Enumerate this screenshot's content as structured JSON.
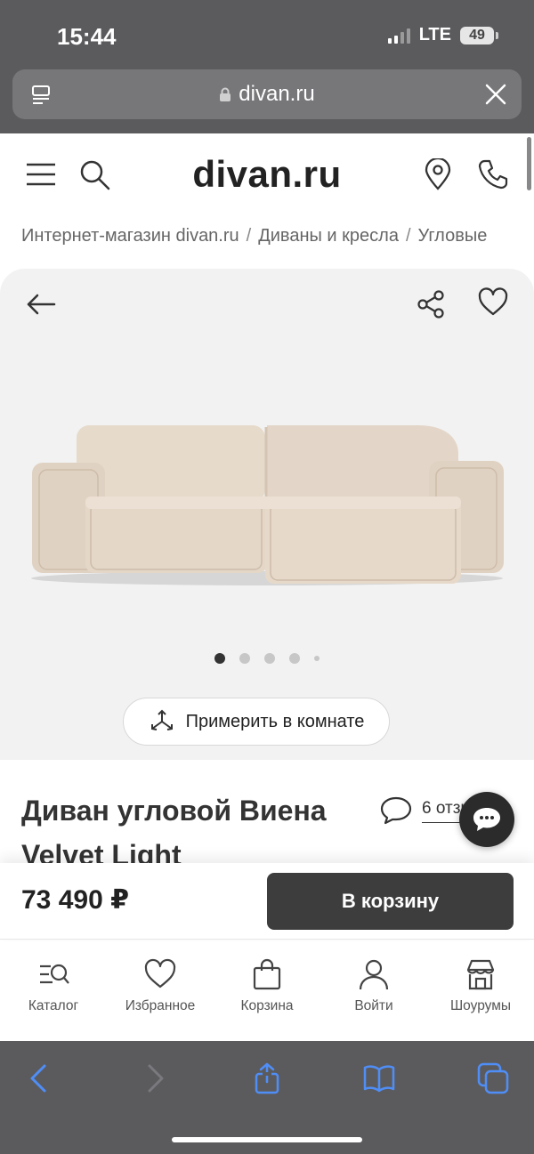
{
  "status_bar": {
    "time": "15:44",
    "network": "LTE",
    "battery": "49"
  },
  "browser": {
    "url": "divan.ru"
  },
  "header": {
    "logo": "divan.ru"
  },
  "breadcrumb": {
    "items": [
      "Интернет-магазин divan.ru",
      "Диваны и кресла",
      "Угловые"
    ]
  },
  "gallery": {
    "slide_count": 5,
    "active_slide": 1,
    "try_in_room_label": "Примерить в комнате"
  },
  "product": {
    "title": "Диван угловой Виена Velvet Light",
    "reviews_label": "6 отзывов",
    "price": "73 490 ₽",
    "add_to_cart_label": "В корзину"
  },
  "tabbar": {
    "items": [
      {
        "label": "Каталог",
        "icon": "catalog-icon"
      },
      {
        "label": "Избранное",
        "icon": "heart-icon"
      },
      {
        "label": "Корзина",
        "icon": "bag-icon"
      },
      {
        "label": "Войти",
        "icon": "user-icon"
      },
      {
        "label": "Шоурумы",
        "icon": "store-icon"
      }
    ]
  },
  "colors": {
    "browser_chrome": "#5b5b5e",
    "accent_button": "#3d3d3d",
    "safari_blue": "#4f8ef7",
    "sofa": "#e3d6c8"
  }
}
